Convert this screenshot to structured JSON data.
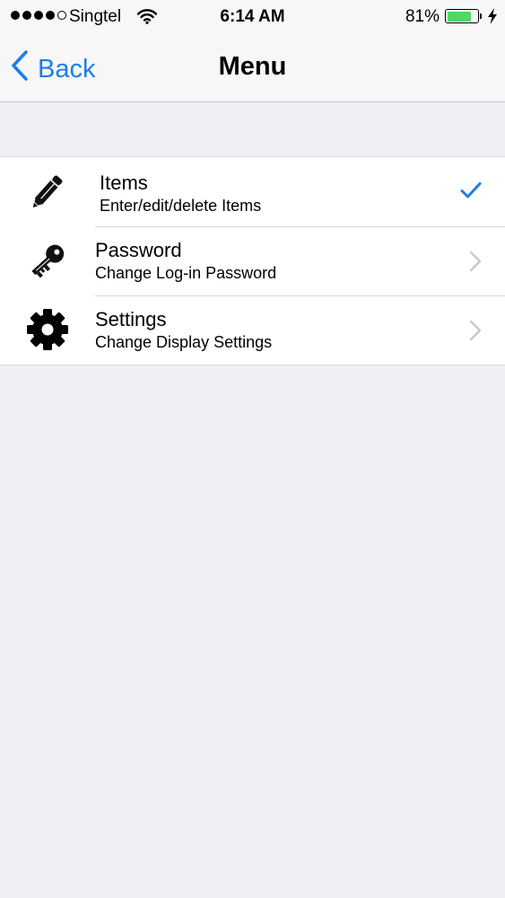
{
  "status_bar": {
    "carrier": "Singtel",
    "time": "6:14 AM",
    "battery_percent": "81%",
    "battery_level": 0.81,
    "signal_bars_filled": 4,
    "signal_bars_total": 5
  },
  "nav": {
    "back_label": "Back",
    "title": "Menu"
  },
  "menu": {
    "items": [
      {
        "title": "Items",
        "subtitle": "Enter/edit/delete Items",
        "icon": "pencil-icon",
        "accessory": "checkmark",
        "selected": true
      },
      {
        "title": "Password",
        "subtitle": "Change Log-in Password",
        "icon": "key-icon",
        "accessory": "chevron"
      },
      {
        "title": "Settings",
        "subtitle": "Change Display Settings",
        "icon": "gear-icon",
        "accessory": "chevron"
      }
    ]
  },
  "colors": {
    "accent": "#1b7fea",
    "battery_fill": "#4cd964",
    "background": "#efeff4"
  }
}
